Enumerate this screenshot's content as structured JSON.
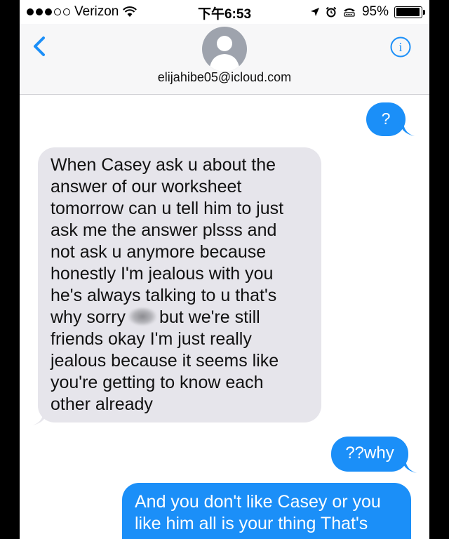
{
  "status_bar": {
    "carrier": "Verizon",
    "time": "下午6:53",
    "battery": "95%",
    "battery_level": 0.95,
    "icons": [
      "signal-dots-icon",
      "wifi-icon",
      "location-arrow-icon",
      "alarm-icon",
      "tty-icon",
      "battery-icon"
    ]
  },
  "header": {
    "contact": "elijahibe05@icloud.com",
    "icons": [
      "back-chevron-icon",
      "avatar-silhouette-icon",
      "info-icon"
    ]
  },
  "messages": [
    {
      "type": "sent",
      "text": "?"
    },
    {
      "type": "received",
      "lines": [
        "When Casey ask u about the",
        "answer of our worksheet",
        "tomorrow can u tell him to just",
        "ask me the answer plsss and",
        "not ask u anymore because",
        "honestly I'm jealous with you",
        "he's always talking to u that's",
        "why sorry",
        "but we're still",
        "friends okay I'm just really",
        "jealous because it seems like",
        "you're getting to know each",
        "other already"
      ]
    },
    {
      "type": "sent",
      "text": "??why"
    },
    {
      "type": "sent",
      "lines": [
        "And you don't like Casey or you",
        "like him all is your thing That's"
      ]
    }
  ],
  "colors": {
    "sent_bubble": "#1b8ff8",
    "received_bubble": "#e6e5eb",
    "accent": "#1b8ff8"
  }
}
